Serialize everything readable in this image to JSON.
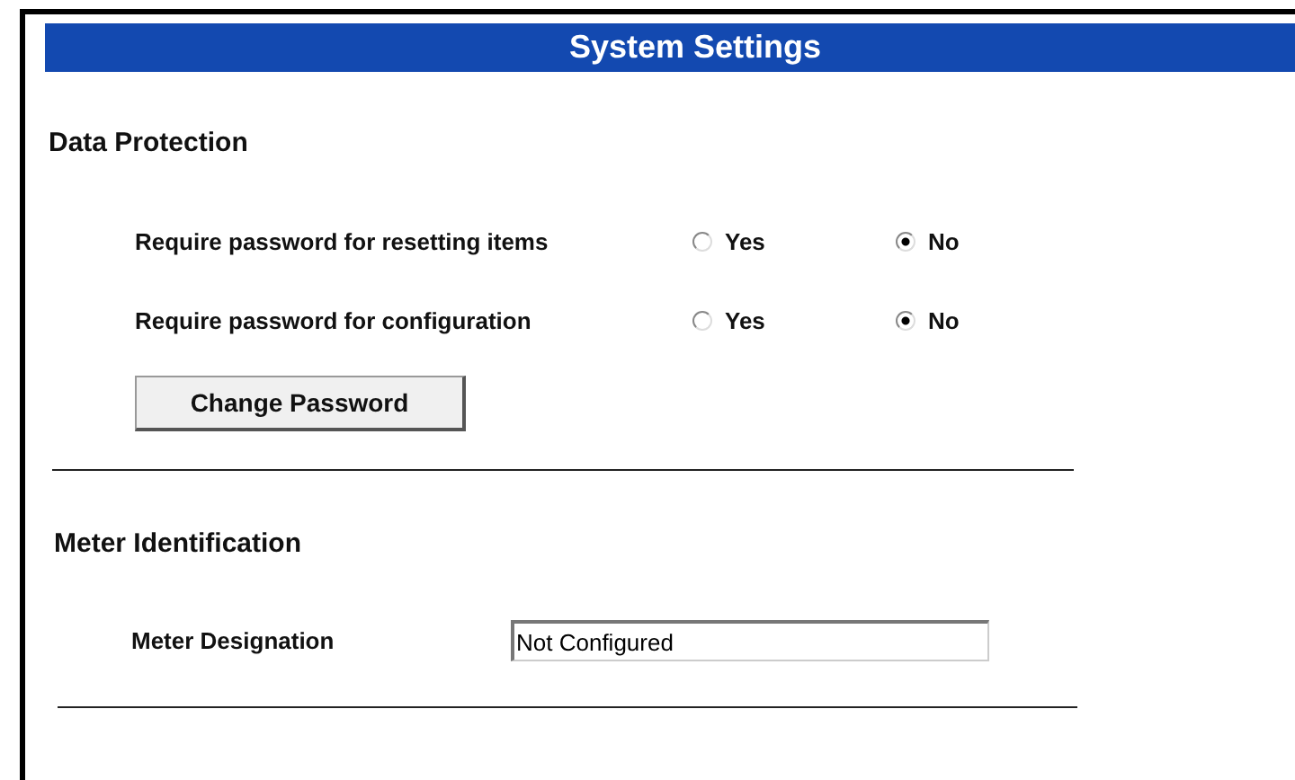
{
  "window": {
    "title": "System Settings"
  },
  "data_protection": {
    "heading": "Data Protection",
    "options": [
      {
        "label": "Require password for resetting items",
        "choices": [
          {
            "label": "Yes",
            "selected": false
          },
          {
            "label": "No",
            "selected": true
          }
        ]
      },
      {
        "label": "Require password for configuration",
        "choices": [
          {
            "label": "Yes",
            "selected": false
          },
          {
            "label": "No",
            "selected": true
          }
        ]
      }
    ],
    "button": "Change Password"
  },
  "meter_identification": {
    "heading": "Meter Identification",
    "field": {
      "label": "Meter Designation",
      "value": "Not Configured"
    }
  }
}
